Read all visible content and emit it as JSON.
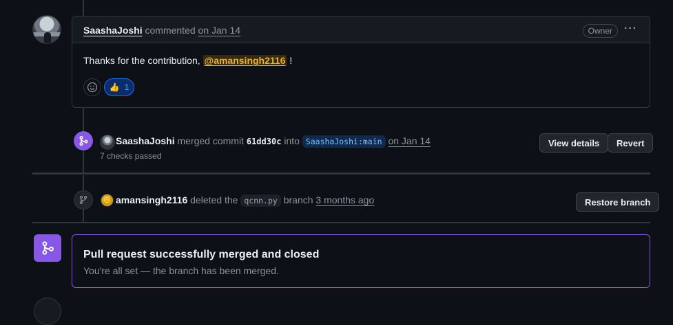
{
  "comment": {
    "author": "SaashaJoshi",
    "action": "commented",
    "date": "on Jan 14",
    "badge": "Owner",
    "menu": "···",
    "text_before": "Thanks for the contribution,",
    "mention": "@amansingh2116",
    "text_after": "!",
    "reaction_emoji": "👍",
    "reaction_count": "1"
  },
  "merge_event": {
    "actor": "SaashaJoshi",
    "action": "merged commit",
    "sha": "61dd30c",
    "into": "into",
    "target": "SaashaJoshi:main",
    "date": "on Jan 14",
    "checks": "7 checks passed",
    "view_details": "View details",
    "revert": "Revert"
  },
  "delete_event": {
    "actor": "amansingh2116",
    "action": "deleted the",
    "branch": "qcnn.py",
    "branch_word": "branch",
    "date": "3 months ago",
    "restore": "Restore branch"
  },
  "merged_status": {
    "title": "Pull request successfully merged and closed",
    "subtitle": "You're all set — the branch has been merged."
  },
  "colors": {
    "background": "#0d1117",
    "merged_purple": "#8957e5",
    "mention_yellow": "#e3b341",
    "link_blue": "#58a6ff"
  }
}
